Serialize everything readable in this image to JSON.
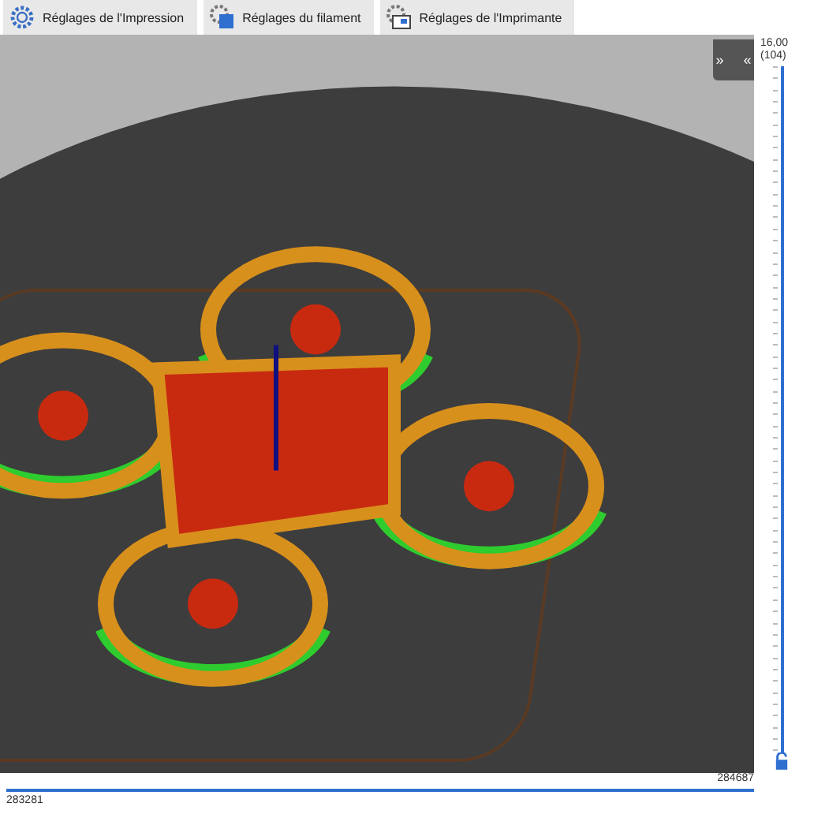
{
  "tabs": [
    {
      "label": "Réglages de l'Impression",
      "selected": false,
      "kind": "print"
    },
    {
      "label": "Réglages du filament",
      "selected": false,
      "kind": "filament"
    },
    {
      "label": "Réglages de l'Imprimante",
      "selected": false,
      "kind": "printer"
    }
  ],
  "viewport": {
    "collapse_button": {
      "label": "» «"
    }
  },
  "vertical_slider": {
    "top_value": "16,00",
    "top_layer": "(104)",
    "level": 1
  },
  "horizontal_slider": {
    "right_value": "284687",
    "left_value": "283281",
    "level": 1
  }
}
